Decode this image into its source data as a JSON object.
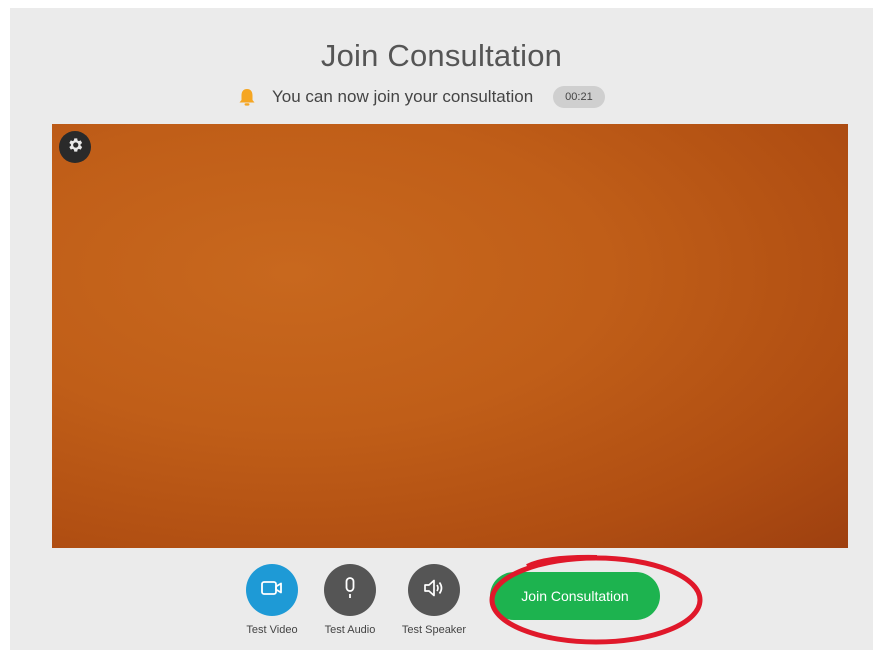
{
  "page": {
    "title": "Join Consultation"
  },
  "notice": {
    "icon": "bell-icon",
    "text": "You can now join your consultation",
    "timer": "00:21"
  },
  "preview": {
    "settings_icon": "gear-icon"
  },
  "controls": {
    "test_video": {
      "label": "Test Video",
      "icon": "video-camera-icon",
      "color": "#1e9ad6"
    },
    "test_audio": {
      "label": "Test Audio",
      "icon": "microphone-icon",
      "color": "#555555"
    },
    "test_speaker": {
      "label": "Test Speaker",
      "icon": "speaker-icon",
      "color": "#555555"
    },
    "join_button": {
      "label": "Join Consultation",
      "color": "#1db34f"
    }
  },
  "colors": {
    "accent": "#1e9ad6",
    "join": "#1db34f",
    "highlight": "#e0182a",
    "warning": "#f5a623"
  }
}
